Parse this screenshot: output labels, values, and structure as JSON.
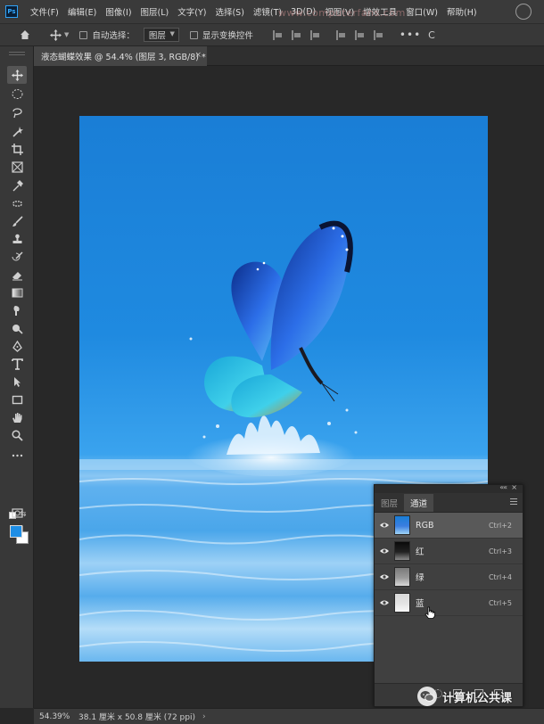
{
  "menubar": {
    "logo": "Ps",
    "items": [
      "文件(F)",
      "编辑(E)",
      "图像(I)",
      "图层(L)",
      "文字(Y)",
      "选择(S)",
      "滤镜(T)",
      "3D(D)",
      "视图(V)",
      "增效工具",
      "窗口(W)",
      "帮助(H)"
    ],
    "watermark": "www.computerfans.com"
  },
  "options": {
    "auto_select_label": "自动选择：",
    "auto_select_target": "图层",
    "show_transform_label": "显示变换控件",
    "more": "•••",
    "extra": "C"
  },
  "document": {
    "tab_title": "液态蝴蝶效果 @ 54.4% (图层 3, RGB/8) *",
    "close_glyph": "×"
  },
  "status": {
    "zoom": "54.39%",
    "doc_size": "38.1 厘米 x 50.8 厘米 (72 ppi)",
    "arrow": "›"
  },
  "channels_panel": {
    "tabs": [
      "图层",
      "通道"
    ],
    "active_tab": "通道",
    "channels": [
      {
        "name": "RGB",
        "shortcut": "Ctrl+2",
        "selected": true
      },
      {
        "name": "红",
        "shortcut": "Ctrl+3",
        "selected": false
      },
      {
        "name": "绿",
        "shortcut": "Ctrl+4",
        "selected": false
      },
      {
        "name": "蓝",
        "shortcut": "Ctrl+5",
        "selected": false
      }
    ],
    "collapse_glyph": "««",
    "close_glyph": "×"
  },
  "wechat_watermark": {
    "text": "计算机公共课"
  },
  "colors": {
    "foreground": "#1e8ee6",
    "background": "#ffffff",
    "accent": "#31a8ff"
  }
}
